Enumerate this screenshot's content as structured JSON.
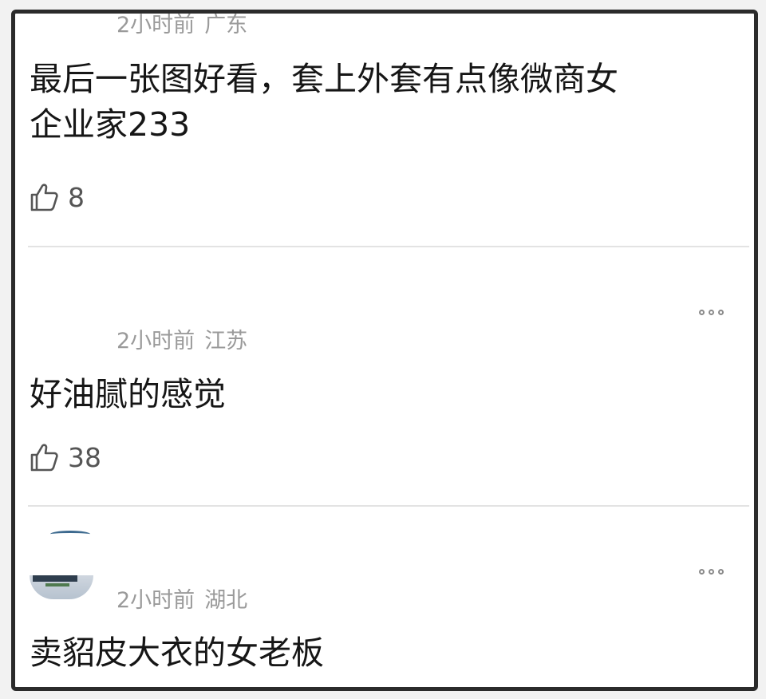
{
  "comments": [
    {
      "time": "2小时前",
      "location": "广东",
      "text_line1": "最后一张图好看，套上外套有点像微商女",
      "text_line2": "企业家233",
      "likes": "8"
    },
    {
      "time": "2小时前",
      "location": "江苏",
      "text": "好油腻的感觉",
      "likes": "38"
    },
    {
      "time": "2小时前",
      "location": "湖北",
      "text": "卖貂皮大衣的女老板"
    }
  ],
  "icons": {
    "like": "thumbs-up-icon",
    "more": "more-options-icon"
  }
}
